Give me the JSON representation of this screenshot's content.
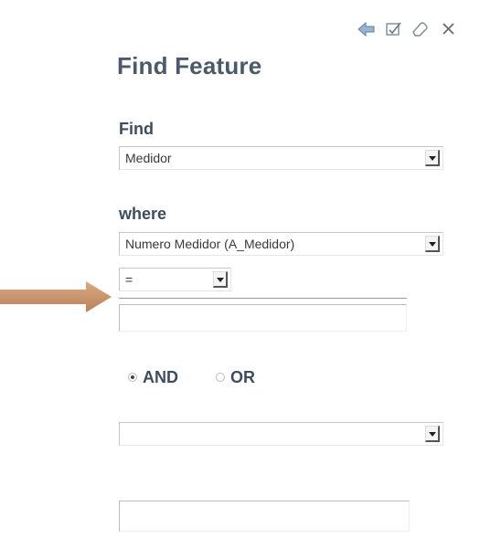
{
  "toolbar": {
    "icons": [
      "back-arrow-icon",
      "edit-checkbox-icon",
      "eraser-icon",
      "close-icon"
    ],
    "close_glyph": "✕"
  },
  "panel": {
    "title": "Find Feature",
    "find": {
      "label": "Find",
      "value": "Medidor"
    },
    "where": {
      "label": "where",
      "field": "Numero Medidor (A_Medidor)",
      "operator": "=",
      "value": ""
    },
    "logic": {
      "and_label": "AND",
      "or_label": "OR",
      "selected": "AND"
    },
    "second_field": {
      "value": ""
    },
    "second_value": {
      "value": ""
    }
  },
  "colors": {
    "title": "#4b5a6a",
    "label": "#3d4d5e",
    "arrow": "#c9946a"
  }
}
